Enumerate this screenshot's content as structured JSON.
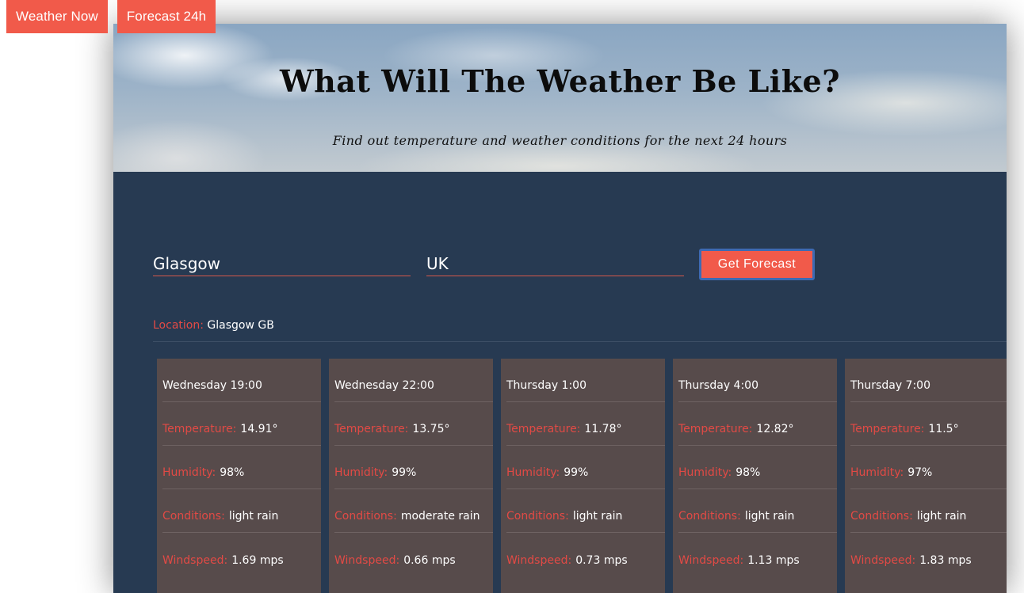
{
  "nav": {
    "weather_now": "Weather Now",
    "forecast_24h": "Forecast 24h"
  },
  "hero": {
    "title": "What Will The Weather Be Like?",
    "subtitle": "Find out temperature and weather conditions for the next 24 hours"
  },
  "form": {
    "city_value": "Glasgow",
    "country_value": "UK",
    "button_label": "Get Forecast"
  },
  "location": {
    "label": "Location:",
    "value": "Glasgow GB"
  },
  "labels": {
    "temperature": "Temperature:",
    "humidity": "Humidity:",
    "conditions": "Conditions:",
    "windspeed": "Windspeed:"
  },
  "forecast": [
    {
      "time": "Wednesday 19:00",
      "temperature": "14.91°",
      "humidity": "98%",
      "conditions": "light rain",
      "windspeed": "1.69 mps"
    },
    {
      "time": "Wednesday 22:00",
      "temperature": "13.75°",
      "humidity": "99%",
      "conditions": "moderate rain",
      "windspeed": "0.66 mps"
    },
    {
      "time": "Thursday 1:00",
      "temperature": "11.78°",
      "humidity": "99%",
      "conditions": "light rain",
      "windspeed": "0.73 mps"
    },
    {
      "time": "Thursday 4:00",
      "temperature": "12.82°",
      "humidity": "98%",
      "conditions": "light rain",
      "windspeed": "1.13 mps"
    },
    {
      "time": "Thursday 7:00",
      "temperature": "11.5°",
      "humidity": "97%",
      "conditions": "light rain",
      "windspeed": "1.83 mps"
    }
  ],
  "colors": {
    "accent": "#f15a4a",
    "panel": "#273a52",
    "card": "#574b4b",
    "label": "#e24a45"
  }
}
